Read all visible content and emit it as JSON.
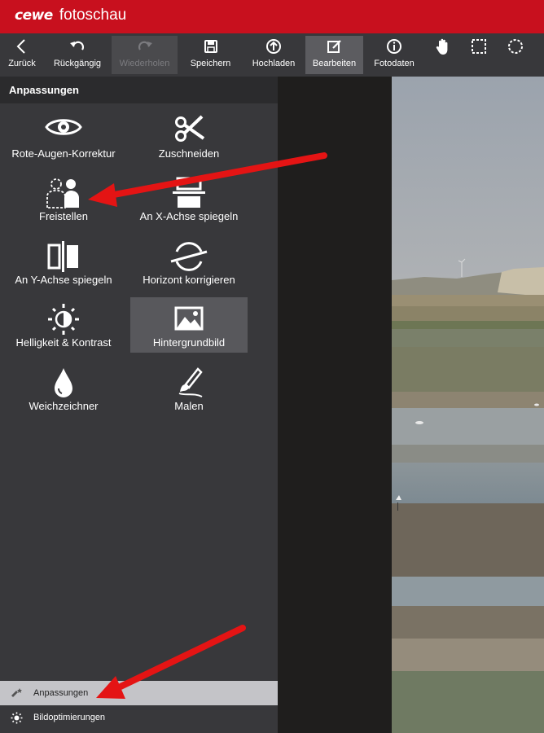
{
  "app": {
    "brand": "cewe",
    "title": "fotoschau",
    "accent": "#c8101e"
  },
  "toolbar": {
    "items": [
      {
        "label": "Zurück",
        "icon": "back-arrow-icon",
        "state": "normal"
      },
      {
        "label": "Rückgängig",
        "icon": "undo-icon",
        "state": "normal"
      },
      {
        "label": "Wiederholen",
        "icon": "redo-icon",
        "state": "disabled"
      },
      {
        "label": "Speichern",
        "icon": "save-icon",
        "state": "normal"
      },
      {
        "label": "Hochladen",
        "icon": "upload-icon",
        "state": "normal"
      },
      {
        "label": "Bearbeiten",
        "icon": "edit-icon",
        "state": "active"
      },
      {
        "label": "Fotodaten",
        "icon": "info-icon",
        "state": "normal"
      }
    ],
    "tools": [
      "hand-icon",
      "rect-select-icon",
      "ellipse-select-icon"
    ]
  },
  "sidebar": {
    "title": "Anpassungen",
    "tools": [
      {
        "label": "Rote-Augen-Korrektur",
        "icon": "eye-icon"
      },
      {
        "label": "Zuschneiden",
        "icon": "scissors-icon"
      },
      {
        "label": "Freistellen",
        "icon": "cutout-icon"
      },
      {
        "label": "An X-Achse spiegeln",
        "icon": "flip-x-icon"
      },
      {
        "label": "An Y-Achse spiegeln",
        "icon": "flip-y-icon"
      },
      {
        "label": "Horizont korrigieren",
        "icon": "horizon-icon"
      },
      {
        "label": "Helligkeit & Kontrast",
        "icon": "brightness-icon"
      },
      {
        "label": "Hintergrundbild",
        "icon": "image-icon",
        "selected": true
      },
      {
        "label": "Weichzeichner",
        "icon": "drop-icon"
      },
      {
        "label": "Malen",
        "icon": "brush-icon"
      }
    ],
    "bottom": [
      {
        "label": "Anpassungen",
        "icon": "adjust-icon",
        "active": true
      },
      {
        "label": "Bildoptimierungen",
        "icon": "sun-icon",
        "active": false
      }
    ]
  }
}
